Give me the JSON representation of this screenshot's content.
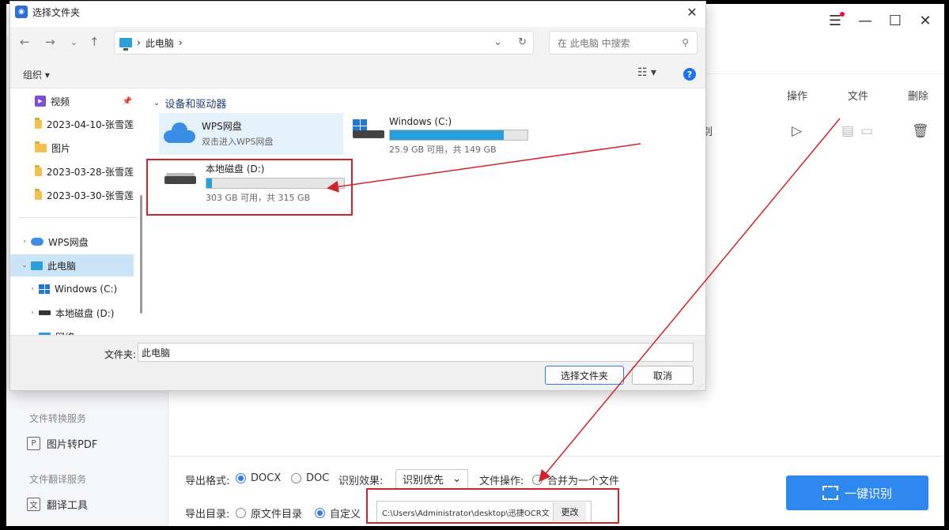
{
  "app": {
    "columns": {
      "operation": "操作",
      "file": "文件",
      "delete": "删除"
    },
    "row_fragment": "别",
    "sidebar": {
      "convert_section": "文件转换服务",
      "img2pdf": "图片转PDF",
      "translate_section": "文件翻译服务",
      "translate_tool": "翻译工具"
    },
    "options": {
      "format_label": "导出格式:",
      "format_docx": "DOCX",
      "format_doc": "DOC",
      "format_selected": "DOCX",
      "effect_label": "识别效果:",
      "effect_value": "识别优先",
      "file_op_label": "文件操作:",
      "merge_label": "合并为一个文件",
      "dir_label": "导出目录:",
      "dir_original": "原文件目录",
      "dir_custom": "自定义",
      "dir_selected": "自定义",
      "path": "C:\\Users\\Administrator\\desktop\\迅捷OCR文",
      "change_button": "更改",
      "ocr_button": "一键识别"
    },
    "accent_color": "#2f88ee"
  },
  "dialog": {
    "title": "选择文件夹",
    "breadcrumb": "此电脑",
    "search_placeholder": "在 此电脑 中搜索",
    "organize": "组织 ▾",
    "nav_items": [
      {
        "label": "视频",
        "pinned": true
      },
      {
        "label": "2023-04-10-张雪莲"
      },
      {
        "label": "图片"
      },
      {
        "label": "2023-03-28-张雪莲"
      },
      {
        "label": "2023-03-30-张雪莲"
      }
    ],
    "tree": [
      {
        "label": "WPS网盘"
      },
      {
        "label": "此电脑",
        "selected": true
      },
      {
        "label": "Windows (C:)"
      },
      {
        "label": "本地磁盘 (D:)"
      },
      {
        "label": "网络"
      }
    ],
    "group_title": "设备和驱动器",
    "tiles": [
      {
        "name": "WPS网盘",
        "sub": "双击进入WPS网盘"
      },
      {
        "name": "Windows (C:)",
        "sub": "25.9 GB 可用，共 149 GB",
        "used_fraction": 0.826
      },
      {
        "name": "本地磁盘 (D:)",
        "sub": "303 GB 可用，共 315 GB",
        "used_fraction": 0.038
      }
    ],
    "folder_label": "文件夹:",
    "folder_value": "此电脑",
    "select_button": "选择文件夹",
    "cancel_button": "取消"
  },
  "colors": {
    "selection": "#cce4f7",
    "annotation_red": "#d2232a",
    "drive_bar": "#26a0da"
  }
}
